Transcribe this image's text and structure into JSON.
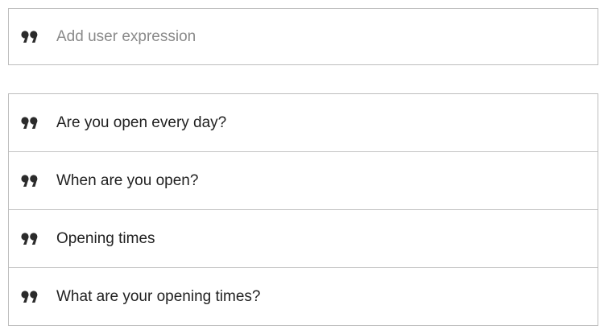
{
  "add_expression": {
    "placeholder": "Add user expression",
    "icon": "quote-icon"
  },
  "expressions": [
    {
      "text": "Are you open every day?",
      "icon": "quote-icon"
    },
    {
      "text": "When are you open?",
      "icon": "quote-icon"
    },
    {
      "text": "Opening times",
      "icon": "quote-icon"
    },
    {
      "text": "What are your opening times?",
      "icon": "quote-icon"
    }
  ],
  "colors": {
    "border": "#bdbdbd",
    "icon": "#2b2b2b",
    "text": "#212121",
    "placeholder": "#8a8a8a"
  }
}
